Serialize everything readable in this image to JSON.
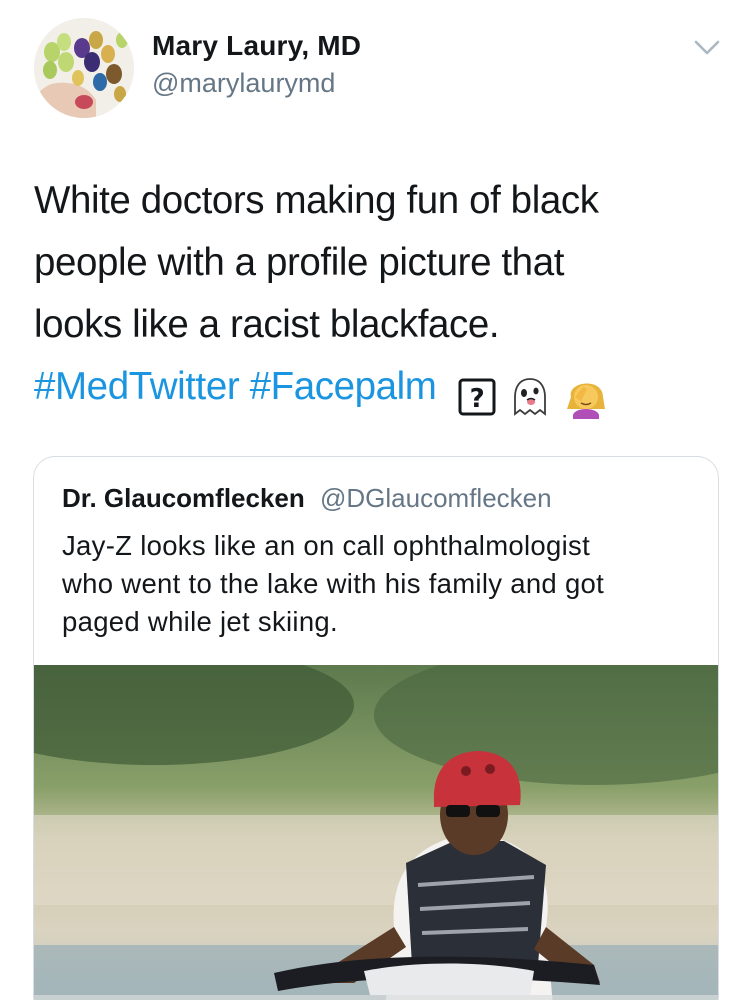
{
  "author": {
    "name": "Mary Laury, MD",
    "handle": "@marylaurymd"
  },
  "tweet": {
    "text_lines": [
      "White doctors making fun of black",
      "people with a profile picture that",
      "looks like a racist blackface."
    ],
    "hashtags": [
      "#MedTwitter",
      "#Facepalm"
    ],
    "emoji": [
      "unknown-glyph-icon",
      "ghost-icon",
      "woman-facepalming-icon"
    ],
    "unknown_glyph": "?"
  },
  "quoted_tweet": {
    "name": "Dr. Glaucomflecken",
    "handle": "@DGlaucomflecken",
    "text_lines": [
      "Jay-Z looks like an on call ophthalmologist",
      "who went to the lake with his family and got",
      "paged while jet skiing."
    ]
  },
  "colors": {
    "text": "#14171a",
    "secondary": "#657786",
    "hashtag": "#1b95e0",
    "border": "#d7dde2"
  }
}
